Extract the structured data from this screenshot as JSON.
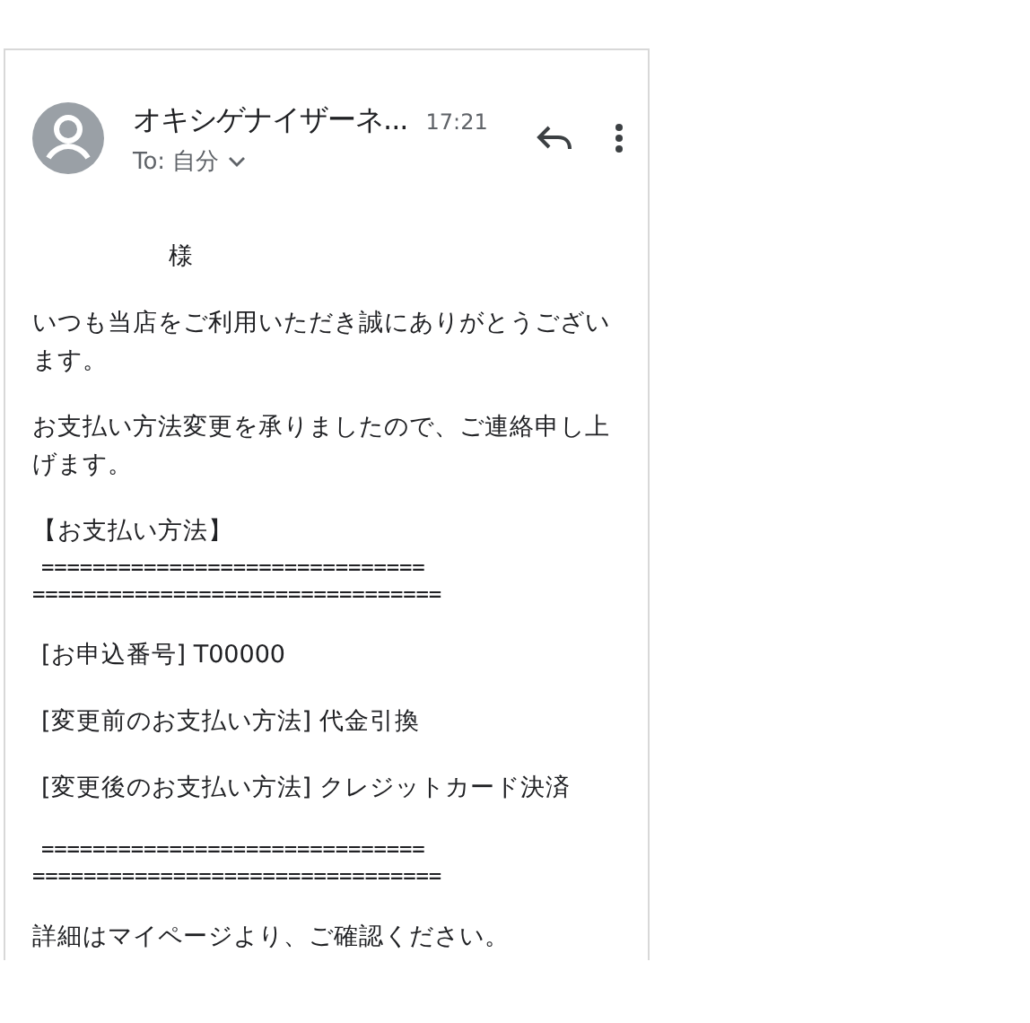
{
  "message": {
    "sender": "オキシゲナイザーネ...",
    "time": "17:21",
    "recipient": "To: 自分"
  },
  "body": [
    {
      "kind": "salutation",
      "lines": [
        "様"
      ]
    },
    {
      "kind": "paragraph",
      "lines": [
        "いつも当店をご利用いただき誠にありがとうございます。"
      ]
    },
    {
      "kind": "paragraph",
      "lines": [
        "お支払い方法変更を承りましたので、ご連絡申し上げます。"
      ]
    },
    {
      "kind": "heading",
      "lines": [
        "【お支払い方法】"
      ]
    },
    {
      "kind": "rule",
      "lines": [
        "==============================",
        "================================"
      ]
    },
    {
      "kind": "item",
      "lines": [
        "[お申込番号] T00000"
      ]
    },
    {
      "kind": "item",
      "lines": [
        "[変更前のお支払い方法] 代金引換"
      ]
    },
    {
      "kind": "item",
      "lines": [
        "[変更後のお支払い方法] クレジットカード決済"
      ]
    },
    {
      "kind": "rule",
      "lines": [
        "==============================",
        "================================"
      ]
    },
    {
      "kind": "paragraph",
      "lines": [
        "詳細はマイページより、ご確認ください。"
      ]
    }
  ]
}
